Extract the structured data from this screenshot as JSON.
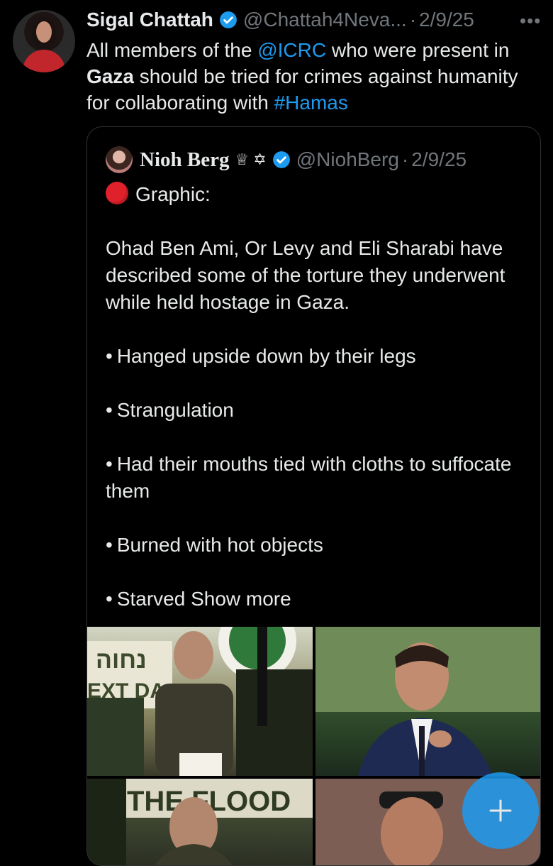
{
  "tweet": {
    "author_name": "Sigal Chattah",
    "handle": "@Chattah4Neva...",
    "separator": "·",
    "date": "2/9/25",
    "more_label": "•••",
    "text": {
      "part1": "All members of the ",
      "mention": "@ICRC",
      "part2": " who were present in ",
      "bold": "Gaza",
      "part3": " should be tried for crimes against humanity for collaborating with ",
      "hashtag": "#Hamas"
    }
  },
  "quoted_tweet": {
    "author_name": "Nioh Berg",
    "symbols": "♕ ✡",
    "handle": "@NiohBerg",
    "separator": "·",
    "date": "2/9/25",
    "graphic_label": "Graphic:",
    "paragraph": "Ohad Ben Ami, Or Levy and Eli Sharabi have described some of the torture they underwent while held hostage in Gaza.",
    "bullets": [
      "Hanged upside down by their legs",
      "Strangulation",
      "Had their mouths tied with cloths to suffocate them",
      "Burned with hot objects",
      "Starved"
    ],
    "show_more": "Show more"
  },
  "media": {
    "tile1_text": "נחוה",
    "tile1_text2": "EXT DA",
    "tile3_text": "THE FLOOD"
  },
  "fab": {
    "label": "+"
  },
  "colors": {
    "link": "#1d9bf0",
    "verified": "#1d9bf0",
    "alert": "#e0202a"
  },
  "icons": [
    "verified-badge-icon",
    "more-options-icon",
    "red-circle-icon",
    "compose-plus-icon"
  ]
}
